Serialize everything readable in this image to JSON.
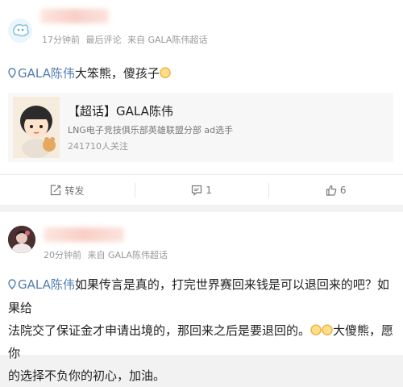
{
  "post1": {
    "meta": {
      "time": "17分钟前",
      "edited": "最后评论",
      "source": "来自 GALA陈伟超话"
    },
    "topic": "GALA陈伟",
    "text": "大笨熊，傻孩子",
    "super_topic": {
      "title": "【超话】GALA陈伟",
      "desc": "LNG电子竞技俱乐部英雄联盟分部 ad选手",
      "followers": "241710人关注"
    },
    "actions": {
      "repost": "转发",
      "comment": "1",
      "like": "6"
    }
  },
  "post2": {
    "meta": {
      "time": "20分钟前",
      "source": "来自 GALA陈伟超话"
    },
    "topic": "GALA陈伟",
    "line1": "如果传言是真的，打完世界赛回来钱是可以退回来的吧？如果给",
    "line2a": "法院交了保证金才申请出境的，那回来之后是要退回的。",
    "line2b": "大傻熊，愿你",
    "line3": "的选择不负你的初心，加油。"
  },
  "colors": {
    "topic": "#507daf",
    "meta": "#999999",
    "background": "#f2f2f2"
  }
}
